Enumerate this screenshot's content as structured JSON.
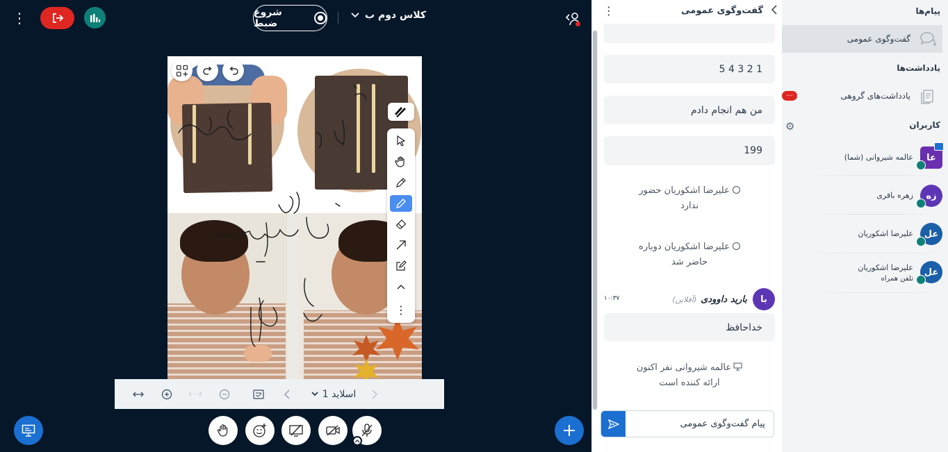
{
  "header": {
    "record_label": "شروع ضبط",
    "meeting_title": "کلاس دوم ب"
  },
  "slide_nav": {
    "slide_label": "اسلاید 1",
    "zoom": "۱۰۰٪"
  },
  "chat": {
    "title": "گفت‌وگوی عمومی",
    "messages": {
      "m1": "1 2 3 4 5",
      "m2": "من هم انجام دادم",
      "m3": "199",
      "sys1_line1": "علیرضا اشکوریان حضور",
      "sys1_line2": "ندارد",
      "sys2_line1": "علیرضا اشکوریان دوباره",
      "sys2_line2": "حاضر شد",
      "sender_initials": "با",
      "sender_name": "بارید داوودی",
      "sender_status": "(آفلاین)",
      "sender_time": "۱۰:۳۷",
      "m4": "خداحافظ",
      "sys3_line1": "عالمه شیروانی نفر اکنون",
      "sys3_line2": "ارائه کننده است"
    },
    "input_placeholder": "پیام گفت‌وگوی عمومی"
  },
  "sidebar": {
    "messages_title": "پیام‌ها",
    "public_chat_label": "گفت‌وگوی عمومی",
    "notes_title": "یادداشت‌ها",
    "group_notes_label": "یادداشت‌های گروهی",
    "users_title": "کاربران",
    "users": [
      {
        "initials": "عا",
        "name": "عالمه شیروانی (شما)",
        "sub": "",
        "color": "#6a2fb0"
      },
      {
        "initials": "زه",
        "name": "زهره باقری",
        "sub": "",
        "color": "#5c36b5"
      },
      {
        "initials": "عل",
        "name": "علیرضا اشکوریان",
        "sub": "",
        "color": "#1b5fa8"
      },
      {
        "initials": "عل",
        "name": "علیرضا اشکوریان",
        "sub": "تلفن همراه",
        "color": "#1b5fa8"
      }
    ]
  },
  "colors": {
    "background": "#06172a",
    "accent": "#1b6fd1",
    "danger": "#df2721",
    "teal": "#0e8077"
  }
}
